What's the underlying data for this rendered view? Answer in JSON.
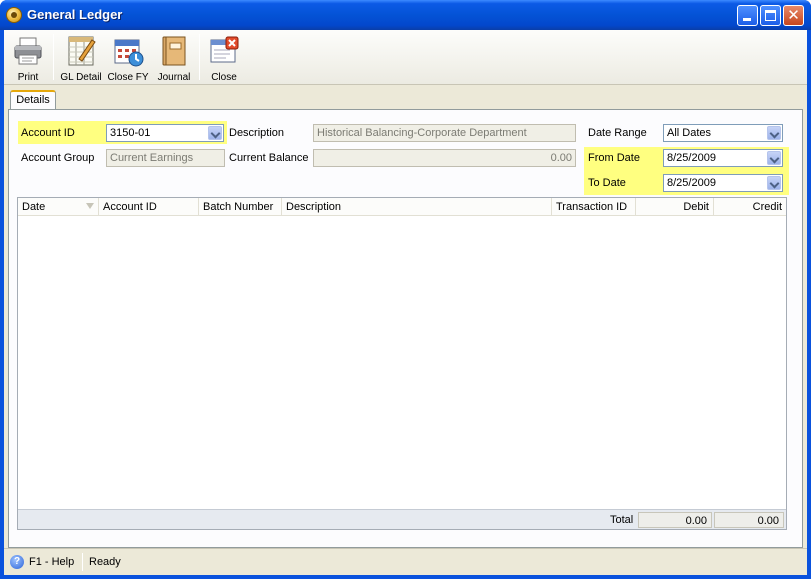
{
  "window": {
    "title": "General Ledger"
  },
  "toolbar": {
    "print": "Print",
    "gl_detail": "GL Detail",
    "close_fy": "Close FY",
    "journal": "Journal",
    "close": "Close"
  },
  "tabs": {
    "details": "Details"
  },
  "form": {
    "account_id_label": "Account ID",
    "account_id_value": "3150-01",
    "description_label": "Description",
    "description_value": "Historical Balancing-Corporate Department",
    "date_range_label": "Date Range",
    "date_range_value": "All Dates",
    "account_group_label": "Account Group",
    "account_group_value": "Current Earnings",
    "current_balance_label": "Current Balance",
    "current_balance_value": "0.00",
    "from_date_label": "From Date",
    "from_date_value": "8/25/2009",
    "to_date_label": "To Date",
    "to_date_value": "8/25/2009"
  },
  "grid": {
    "columns": [
      "Date",
      "Account ID",
      "Batch Number",
      "Description",
      "Transaction ID",
      "Debit",
      "Credit"
    ],
    "rows": [],
    "total_label": "Total",
    "total_debit": "0.00",
    "total_credit": "0.00"
  },
  "statusbar": {
    "help": "F1 - Help",
    "status": "Ready"
  },
  "colors": {
    "title_bar": "#0453d6",
    "required_highlight": "#ffff80",
    "panel_background": "#ece9d8"
  }
}
